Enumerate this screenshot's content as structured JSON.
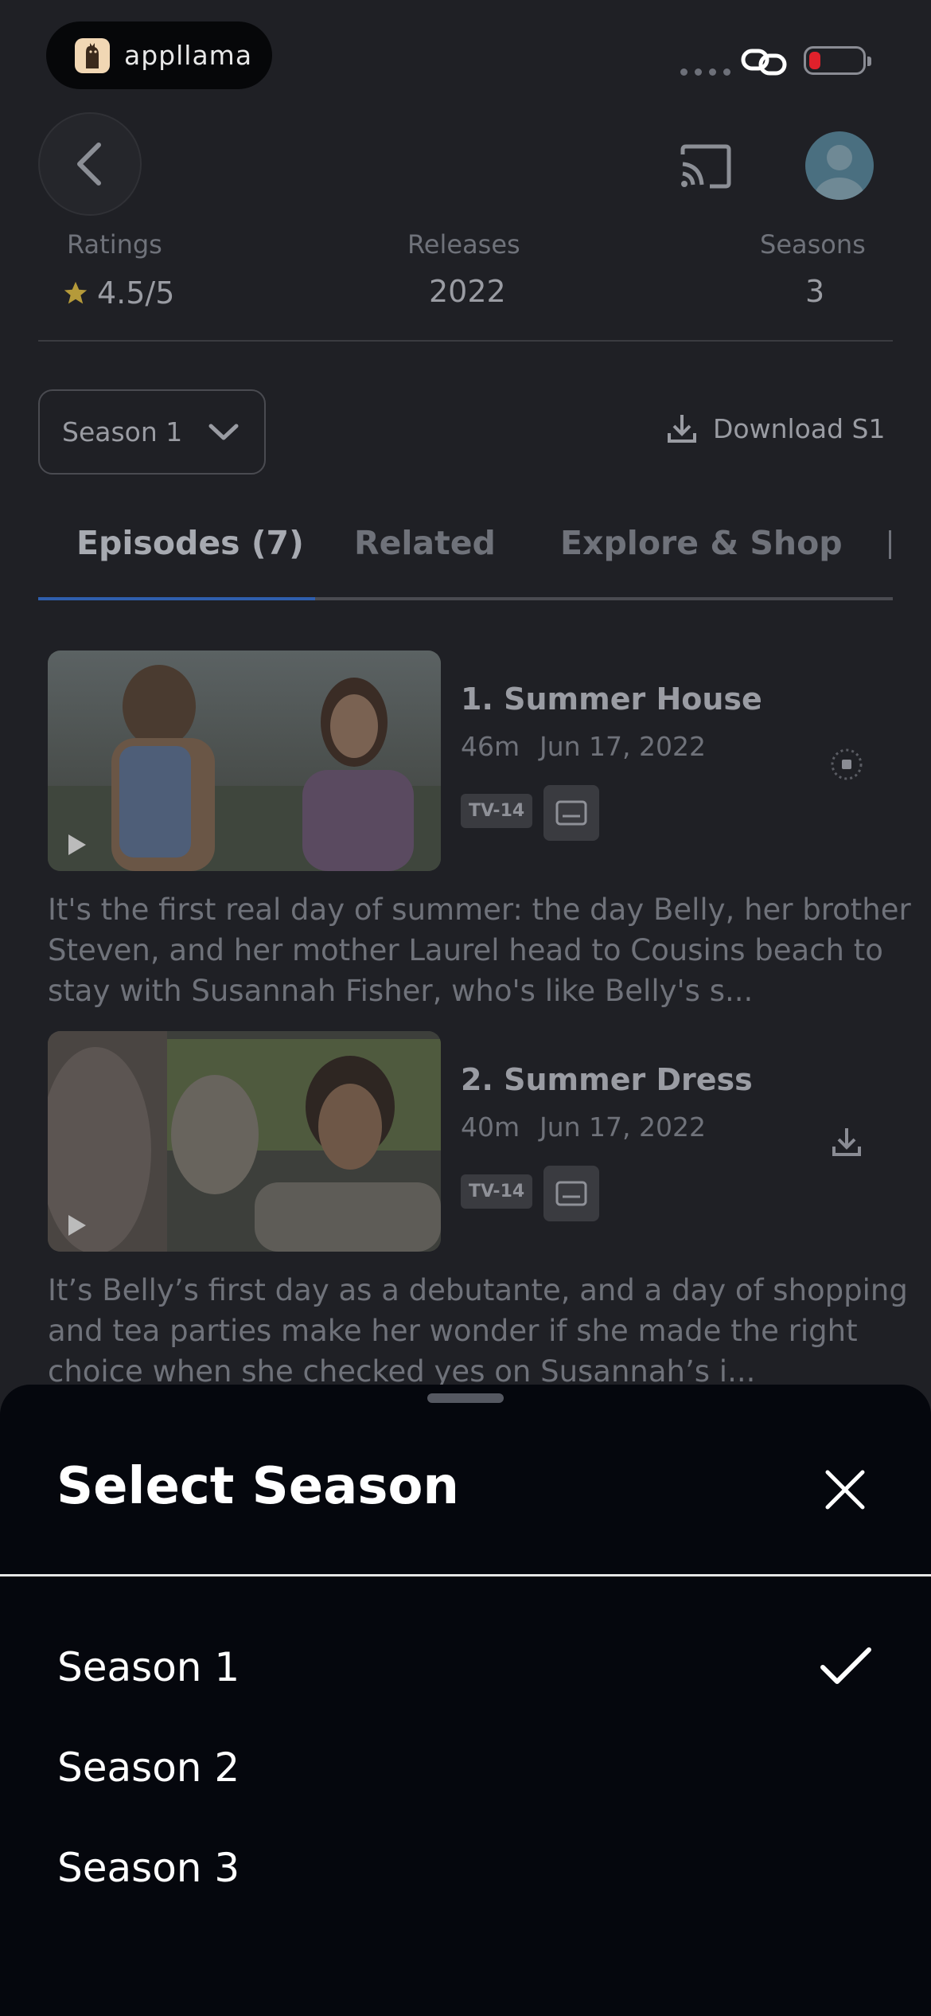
{
  "status_bar": {
    "app_name": "appllama",
    "battery_color": "#e0212b"
  },
  "header": {
    "back_icon": "chevron-left-icon",
    "cast_icon": "cast-icon",
    "avatar_icon": "user-avatar-icon"
  },
  "stats": {
    "ratings_label": "Ratings",
    "ratings_value": "4.5/5",
    "releases_label": "Releases",
    "releases_value": "2022",
    "seasons_label": "Seasons",
    "seasons_value": "3",
    "star_color": "#b59a3a"
  },
  "season_selector": {
    "label": "Season 1",
    "download_label": "Download S1"
  },
  "tabs": [
    {
      "label": "Episodes (7)"
    },
    {
      "label": "Related"
    },
    {
      "label": "Explore & Shop"
    }
  ],
  "accent_color": "#2f5fae",
  "episodes": [
    {
      "title": "1. Summer House",
      "duration": "46m",
      "date": "Jun 17, 2022",
      "rating": "TV-14",
      "description": "It's the first real day of summer: the day Belly, her brother Steven, and her mother Laurel head to Cousins beach to stay with Susannah Fisher, who's like Belly's s...",
      "status": "downloading"
    },
    {
      "title": "2. Summer Dress",
      "duration": "40m",
      "date": "Jun 17, 2022",
      "rating": "TV-14",
      "description": "It’s Belly’s first day as a debutante, and a day of shopping and tea parties make her wonder if she made the right choice when she checked yes on Susannah’s i...",
      "status": "download"
    }
  ],
  "sheet": {
    "title": "Select Season",
    "options": [
      {
        "label": "Season 1",
        "selected": true
      },
      {
        "label": "Season 2",
        "selected": false
      },
      {
        "label": "Season 3",
        "selected": false
      }
    ]
  }
}
